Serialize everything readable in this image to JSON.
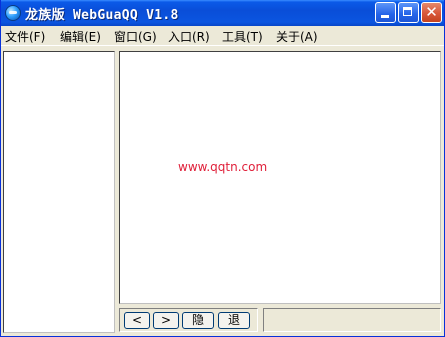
{
  "window": {
    "title": "龙族版 WebGuaQQ V1.8",
    "close_glyph": "✕"
  },
  "menubar": {
    "items": [
      {
        "label": "文件(F)"
      },
      {
        "label": "编辑(E)"
      },
      {
        "label": "窗口(G)"
      },
      {
        "label": "入口(R)"
      },
      {
        "label": "工具(T)"
      },
      {
        "label": "关于(A)"
      }
    ]
  },
  "main": {
    "watermark": "www.qqtn.com"
  },
  "nav": {
    "back_label": "<",
    "forward_label": ">",
    "hide_label": "隐",
    "exit_label": "退"
  },
  "colors": {
    "titlebar": "#0A4ED8",
    "watermark": "#E0203A",
    "frame": "#ECE9D8"
  }
}
